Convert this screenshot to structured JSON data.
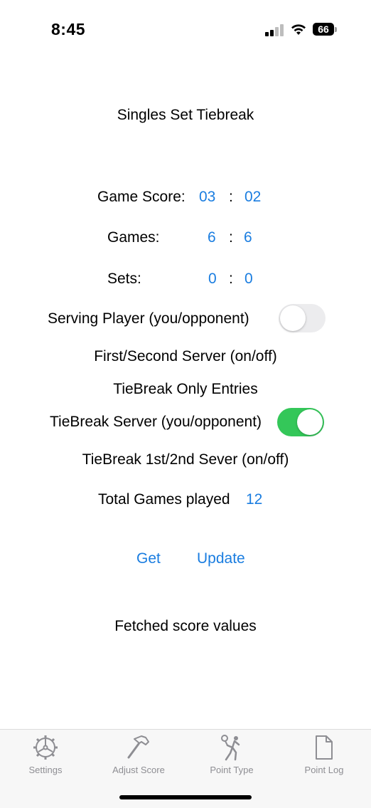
{
  "status_bar": {
    "time": "8:45",
    "battery": "66"
  },
  "title": "Singles Set Tiebreak",
  "game_score": {
    "label": "Game Score:",
    "left": "03",
    "sep": ":",
    "right": "02"
  },
  "games": {
    "label": "Games:",
    "left": "6",
    "sep": ":",
    "right": "6"
  },
  "sets": {
    "label": "Sets:",
    "left": "0",
    "sep": ":",
    "right": "0"
  },
  "serving_player": {
    "label": "Serving Player (you/opponent)",
    "on": false
  },
  "first_second_server": {
    "label": "First/Second Server (on/off)"
  },
  "tiebreak_only": {
    "label": "TieBreak Only Entries"
  },
  "tiebreak_server": {
    "label": "TieBreak Server (you/opponent)",
    "on": true
  },
  "tiebreak_sever": {
    "label": "TieBreak 1st/2nd Sever (on/off)"
  },
  "total_games": {
    "label": "Total Games played",
    "value": "12"
  },
  "actions": {
    "get": "Get",
    "update": "Update"
  },
  "fetched": "Fetched score values",
  "tabs": [
    {
      "label": "Settings",
      "icon": "gear-icon"
    },
    {
      "label": "Adjust Score",
      "icon": "hammer-icon"
    },
    {
      "label": "Point Type",
      "icon": "tennis-player-icon"
    },
    {
      "label": "Point Log",
      "icon": "document-icon"
    }
  ],
  "colors": {
    "accent": "#1a7de0",
    "toggle_on": "#34c759",
    "toggle_off": "#ececee",
    "tab_label": "#8e8e93"
  }
}
